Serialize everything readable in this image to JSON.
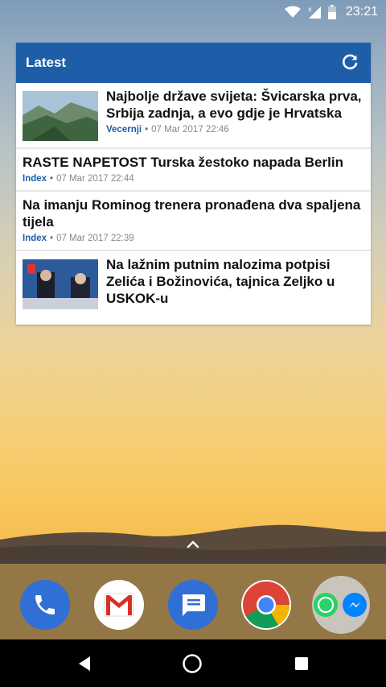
{
  "status": {
    "time": "23:21"
  },
  "widget": {
    "title": "Latest",
    "items": [
      {
        "headline": "Najbolje države svijeta: Švicarska prva, Srbija zadnja, a evo gdje je Hrvatska",
        "source": "Vecernji",
        "time": "07 Mar 2017 22:46",
        "has_image": true
      },
      {
        "headline": "RASTE NAPETOST Turska žestoko napada Berlin",
        "source": "Index",
        "time": "07 Mar 2017 22:44",
        "has_image": false
      },
      {
        "headline": "Na imanju Rominog trenera pronađena dva spaljena tijela",
        "source": "Index",
        "time": "07 Mar 2017 22:39",
        "has_image": false
      },
      {
        "headline": "Na lažnim putnim nalozima potpisi Zelića i Božinovića, tajnica Zeljko u USKOK-u",
        "source": "",
        "time": "",
        "has_image": true
      }
    ]
  },
  "dock": {
    "apps": [
      "phone-icon",
      "gmail-icon",
      "messages-icon",
      "chrome-icon",
      "whatsapp-messenger-folder"
    ]
  },
  "colors": {
    "header": "#1e5ea8",
    "accent": "#1e5ea8"
  }
}
